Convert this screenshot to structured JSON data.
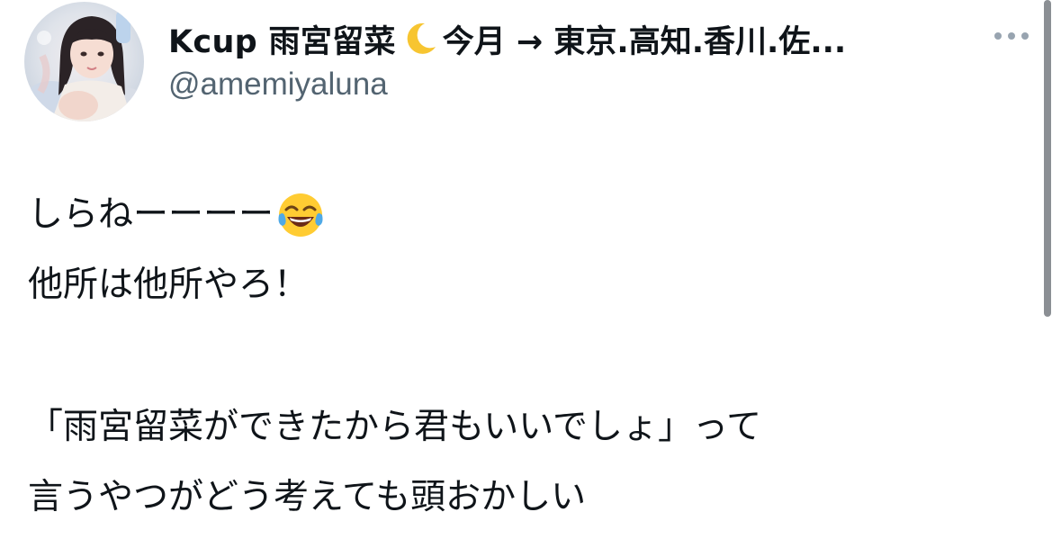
{
  "header": {
    "display_name": "Kcup 雨宮留菜",
    "name_emoji": "crescent-moon-icon",
    "name_suffix": "今月 → 東京.高知.香川.佐...",
    "handle": "@amemiyaluna",
    "more_icon": "more-icon"
  },
  "tweet": {
    "lines": [
      "しらねーーーー",
      "他所は他所やろ！",
      "",
      "「雨宮留菜ができたから君もいいでしょ」って",
      "言うやつがどう考えても頭おかしい"
    ],
    "line1_emoji": "tears-of-joy-icon"
  },
  "colors": {
    "text": "#0f1419",
    "secondary_text": "#536471",
    "background": "#ffffff",
    "scrollbar": "#8b8f94",
    "moon": "#f7c531"
  }
}
